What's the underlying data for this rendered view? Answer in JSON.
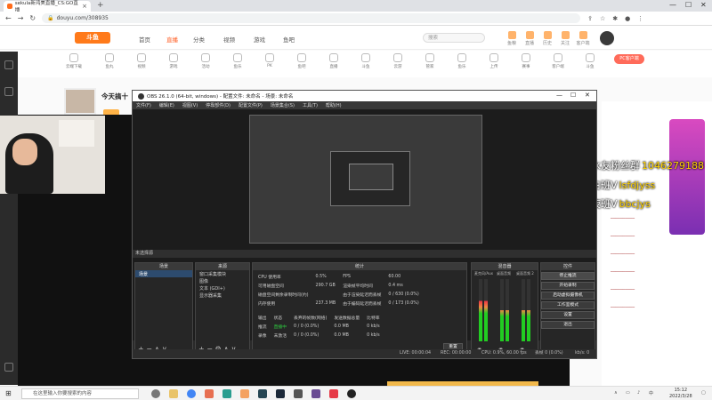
{
  "browser": {
    "tab_title": "sekula新鸿美直播_CS:GO直播_",
    "url": "douyu.com/308935",
    "tab_close": "×",
    "new_tab": "+"
  },
  "site": {
    "logo": "斗鱼",
    "nav": [
      "首页",
      "直播",
      "分类",
      "视频",
      "游戏",
      "鱼吧"
    ],
    "search_placeholder": "搜索",
    "top_icons": [
      "鱼粮",
      "直播",
      "历史",
      "关注",
      "客户端",
      "签到"
    ],
    "categories": [
      "云端下载",
      "鱼丸",
      "视频",
      "游戏",
      "活动",
      "鱼乐",
      "PK",
      "鱼吧",
      "直播",
      "斗鱼",
      "云游",
      "管家",
      "鱼乐",
      "上传",
      "赛事",
      "客户端",
      "斗鱼",
      "广场",
      "主播"
    ],
    "pc_button": "PC客户端"
  },
  "stream": {
    "anchor_title": "今天搞十"
  },
  "danmaku": [
    {
      "white": "水友粉丝群",
      "yellow": "1046279188"
    },
    {
      "white": "白班V",
      "yellow": "lsfdjyss"
    },
    {
      "white": "夜班V",
      "yellow": "bbcjys"
    }
  ],
  "obs": {
    "title": "OBS 26.1.0 (64-bit, windows) - 配置文件: 未命名 - 场景: 未命名",
    "menu": [
      "文件(F)",
      "编辑(E)",
      "视图(V)",
      "停靠部件(D)",
      "配置文件(P)",
      "场景集合(S)",
      "工具(T)",
      "帮助(H)"
    ],
    "scene_bar": "未选择源",
    "scenes_header": "场景",
    "scenes": [
      "场景"
    ],
    "sources_header": "来源",
    "sources": [
      "窗口采集模块",
      "图像",
      "文本 (GDI+)",
      "显示器采集"
    ],
    "stats_header": "统计",
    "stats_rows": [
      [
        "CPU 使用率",
        "0.5%",
        "FPS",
        "60.00"
      ],
      [
        "可用磁盘空间",
        "290.7 GB",
        "渲染帧平均时间",
        "0.4 ms"
      ],
      [
        "磁盘空间剩余录制时间(约)",
        "",
        "由于渲染延迟而丢帧",
        "0 / 630 (0.0%)"
      ],
      [
        "内存使用",
        "237.3 MB",
        "由于编码延迟而丢帧",
        "0 / 173 (0.0%)"
      ]
    ],
    "output_header": [
      "输出",
      "状态",
      "丢弃的帧数(网络)",
      "发送数据总量",
      "比特率"
    ],
    "output_rows": [
      [
        "推流",
        "直播中",
        "0 / 0 (0.0%)",
        "0.0 MB",
        "0 kb/s"
      ],
      [
        "录像",
        "未激活",
        "0 / 0 (0.0%)",
        "0.0 MB",
        "0 kb/s"
      ]
    ],
    "reset_button": "重置",
    "mixer_header": "混音器",
    "mixer_labels": [
      "麦克风/Aux",
      "桌面音频",
      "桌面音频 2"
    ],
    "controls_header": "控件",
    "controls": [
      "停止推流",
      "开始录制",
      "启动虚拟摄像机",
      "工作室模式",
      "设置",
      "退出"
    ],
    "status": {
      "live": "LIVE: 00:00:04",
      "rec": "REC: 00:00:00",
      "cpu": "CPU: 0.9%, 60.00 fps",
      "dropped": "丢帧 0 (0.0%)",
      "kbps": "kb/s: 0"
    }
  },
  "taskbar": {
    "search": "在这里输入你要搜索的内容",
    "time": "15:12",
    "date": "2022/3/28"
  }
}
